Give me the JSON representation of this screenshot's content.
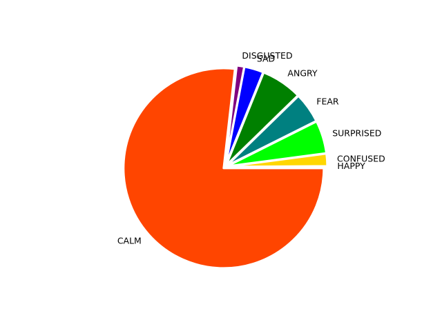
{
  "chart_data": {
    "type": "pie",
    "title": "",
    "categories": [
      "HAPPY",
      "CONFUSED",
      "SURPRISED",
      "FEAR",
      "ANGRY",
      "SAD",
      "DISGUSTED",
      "CALM"
    ],
    "values": [
      0.1,
      2.0,
      5.3,
      4.9,
      6.6,
      3.1,
      1.2,
      76.8
    ],
    "colors": [
      "#ffff00",
      "#ffd700",
      "#00ff00",
      "#008080",
      "#008000",
      "#0000ff",
      "#800080",
      "#ff4500"
    ],
    "exploded": true,
    "start_angle_deg": 0,
    "direction": "counterclockwise",
    "legend": "none"
  }
}
